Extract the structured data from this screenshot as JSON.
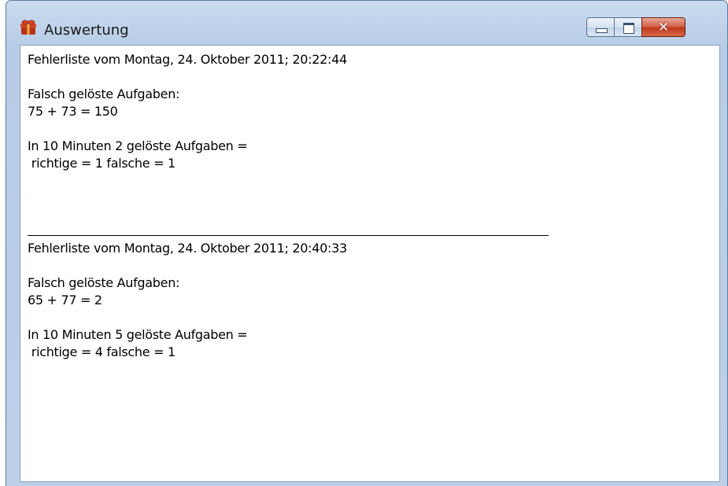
{
  "window": {
    "title": "Auswertung",
    "icon": "gift-icon",
    "controls": {
      "minimize": "minimize-icon",
      "maximize": "maximize-icon",
      "close": "✕"
    }
  },
  "entries": [
    {
      "header": "Fehlerliste vom Montag, 24. Oktober 2011; 20:22:44",
      "wrong_label": "Falsch gelöste Aufgaben:",
      "wrong_item": "75 + 73 = 150",
      "summary": "In 10 Minuten 2 gelöste Aufgaben =",
      "result": " richtige = 1 falsche = 1"
    },
    {
      "header": "Fehlerliste vom Montag, 24. Oktober 2011; 20:40:33",
      "wrong_label": "Falsch gelöste Aufgaben:",
      "wrong_item": "65 + 77 = 2",
      "summary": "In 10 Minuten 5 gelöste Aufgaben =",
      "result": " richtige = 4 falsche = 1"
    }
  ]
}
